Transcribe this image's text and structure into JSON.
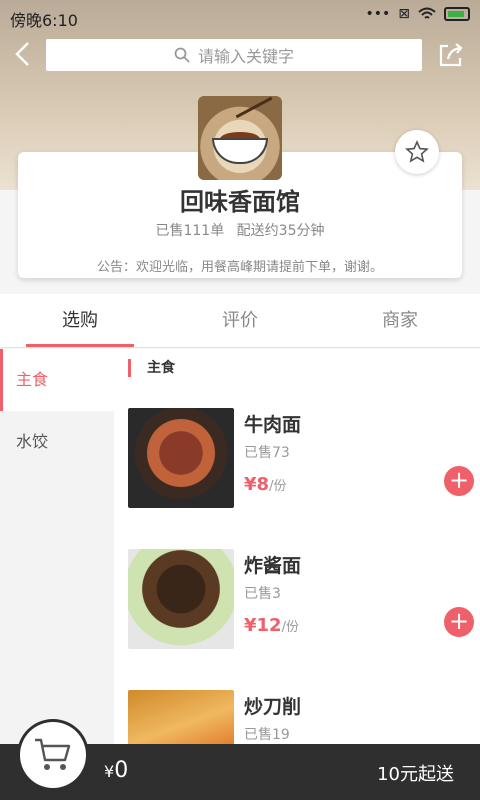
{
  "status_bar": {
    "time": "傍晚6:10",
    "dots": "•••"
  },
  "header": {
    "search_placeholder": "请输入关键字"
  },
  "shop": {
    "name": "回味香面馆",
    "sold_text": "已售111单",
    "delivery_text": "配送约35分钟",
    "notice": "公告：欢迎光临，用餐高峰期请提前下单，谢谢。"
  },
  "tabs": [
    {
      "label": "选购",
      "active": true
    },
    {
      "label": "评价",
      "active": false
    },
    {
      "label": "商家",
      "active": false
    }
  ],
  "sidebar": {
    "items": [
      {
        "label": "主食",
        "active": true
      },
      {
        "label": "水饺",
        "active": false
      }
    ]
  },
  "category": {
    "title": "主食"
  },
  "dishes": [
    {
      "name": "牛肉面",
      "sold": "已售73",
      "currency": "¥",
      "price": "8",
      "unit": "/份"
    },
    {
      "name": "炸酱面",
      "sold": "已售3",
      "currency": "¥",
      "price": "12",
      "unit": "/份"
    },
    {
      "name": "炒刀削",
      "sold": "已售19",
      "currency": "¥",
      "price": "",
      "unit": ""
    }
  ],
  "footer": {
    "currency": "¥",
    "total": "0",
    "min_order": "10元起送"
  },
  "colors": {
    "accent": "#f0606a",
    "footer_bg": "#2f2f2f"
  },
  "icons": [
    "back-arrow-icon",
    "search-icon",
    "share-icon",
    "star-icon",
    "plus-icon",
    "cart-icon",
    "wifi-icon",
    "battery-icon"
  ]
}
